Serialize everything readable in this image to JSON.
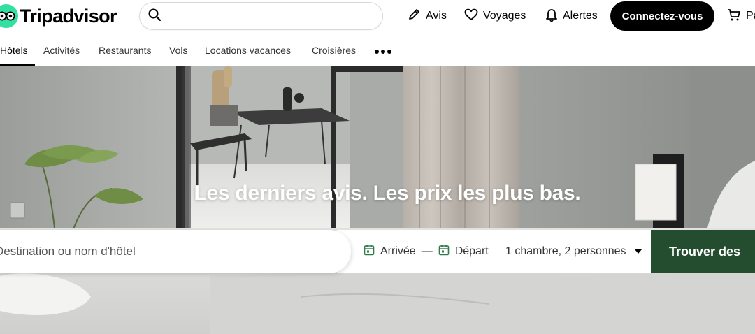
{
  "header": {
    "brand": "Tripadvisor",
    "search": {
      "value": "",
      "placeholder": ""
    },
    "actions": {
      "reviews": "Avis",
      "trips": "Voyages",
      "alerts": "Alertes",
      "signin": "Connectez-vous",
      "cart": "Pa"
    }
  },
  "tabs": [
    {
      "label": "Hôtels",
      "active": true
    },
    {
      "label": "Activités"
    },
    {
      "label": "Restaurants"
    },
    {
      "label": "Vols"
    },
    {
      "label": "Locations vacances"
    },
    {
      "label": "Croisières"
    }
  ],
  "hero": {
    "title": "Les derniers avis. Les prix les plus bas.",
    "destination": {
      "value": "",
      "placeholder": "Destination ou nom d'hôtel"
    },
    "checkin": "Arrivée",
    "separator": "—",
    "checkout": "Départ",
    "guests": "1 chambre, 2 personnes",
    "submit": "Trouver des"
  },
  "colors": {
    "brand_green": "#34e0a1",
    "submit_green": "#244d2f",
    "signin_bg": "#000000",
    "calendar_icon": "#2d7a4a"
  },
  "icons": {
    "logo": "owl-eyes-icon",
    "search": "search-icon",
    "reviews": "pencil-icon",
    "trips": "heart-icon",
    "alerts": "bell-icon",
    "cart": "cart-icon",
    "more": "more-dots-icon",
    "calendar": "calendar-icon",
    "dropdown": "caret-down-icon"
  }
}
